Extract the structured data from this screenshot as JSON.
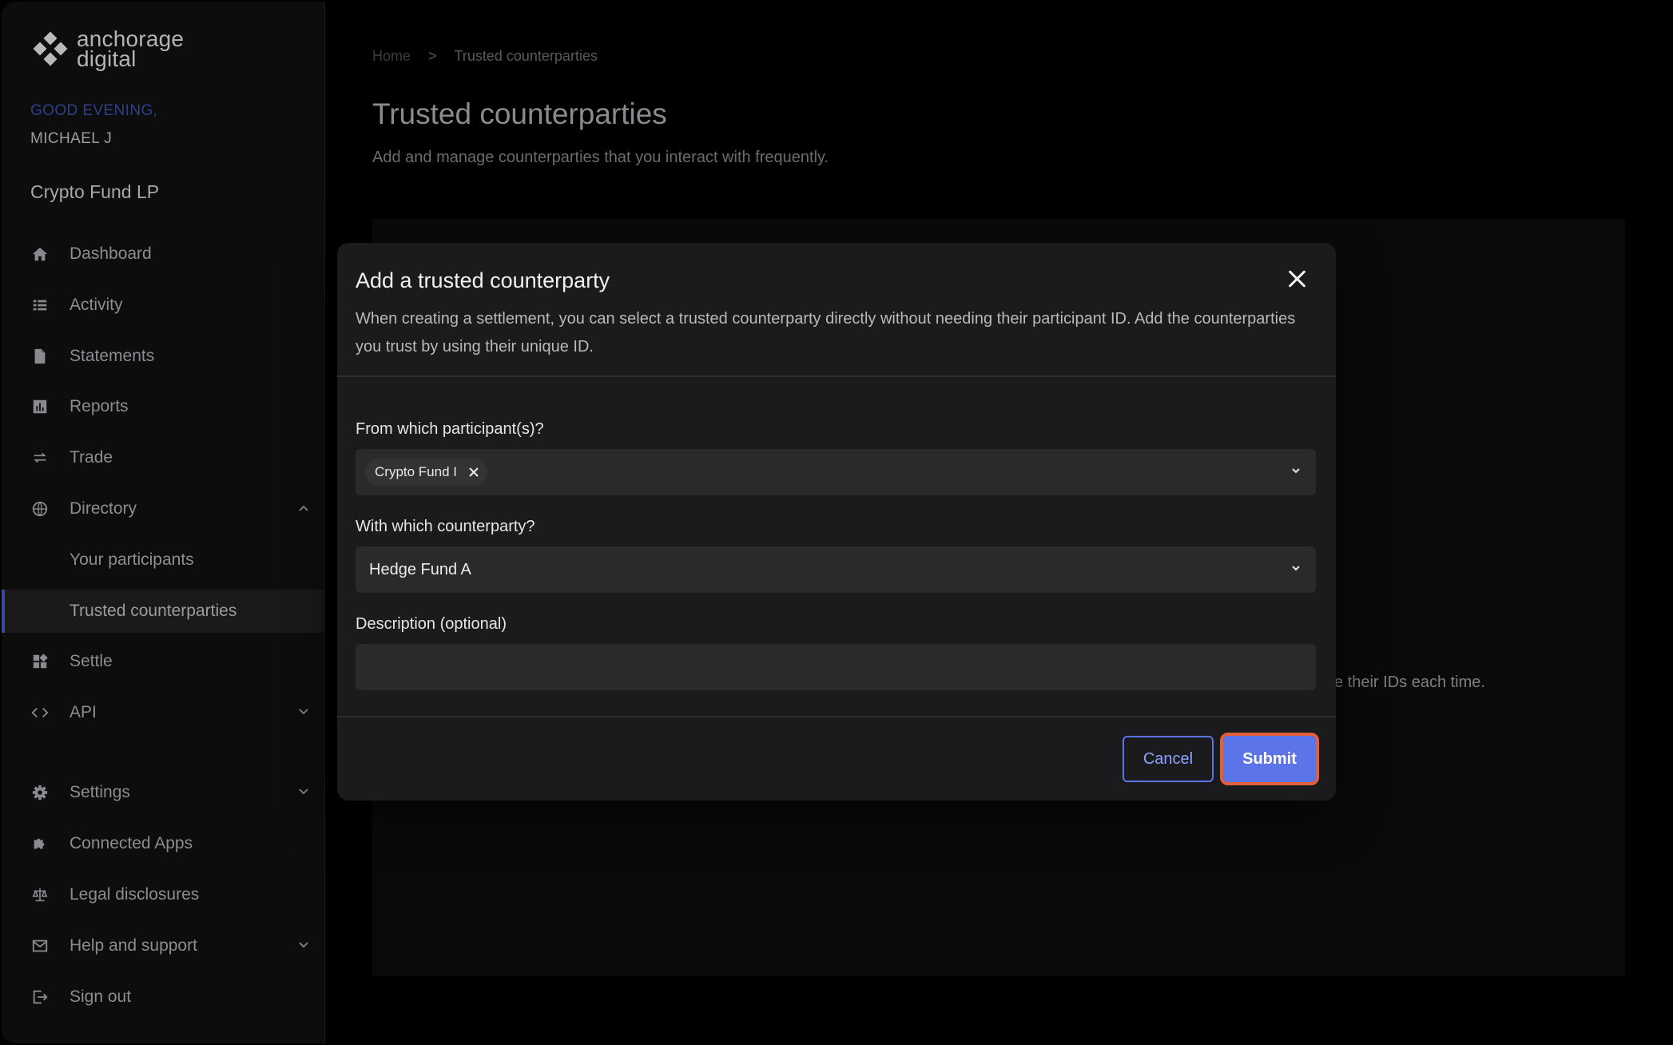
{
  "sidebar": {
    "brand": {
      "line1": "anchorage",
      "line2": "digital"
    },
    "greeting": "GOOD EVENING,",
    "user": "MICHAEL J",
    "org": "Crypto Fund LP",
    "items": [
      {
        "label": "Dashboard",
        "icon": "home-icon"
      },
      {
        "label": "Activity",
        "icon": "list-icon"
      },
      {
        "label": "Statements",
        "icon": "document-icon"
      },
      {
        "label": "Reports",
        "icon": "bar-chart-icon"
      },
      {
        "label": "Trade",
        "icon": "arrows-icon"
      },
      {
        "label": "Directory",
        "icon": "globe-icon",
        "expanded": true
      },
      {
        "label": "Your participants"
      },
      {
        "label": "Trusted counterparties",
        "active": true
      },
      {
        "label": "Settle",
        "icon": "grid-icon"
      },
      {
        "label": "API",
        "icon": "code-icon"
      },
      {
        "label": "Settings",
        "icon": "gear-icon"
      },
      {
        "label": "Connected Apps",
        "icon": "puzzle-icon"
      },
      {
        "label": "Legal disclosures",
        "icon": "scale-icon"
      },
      {
        "label": "Help and support",
        "icon": "mail-icon"
      },
      {
        "label": "Sign out",
        "icon": "sign-out-icon"
      }
    ]
  },
  "main": {
    "breadcrumb": {
      "home": "Home",
      "separator": ">",
      "current": "Trusted counterparties"
    },
    "title": "Trusted counterparties",
    "subtitle": "Add and manage counterparties that you interact with frequently.",
    "panel_text": "e their IDs each time."
  },
  "modal": {
    "title": "Add a trusted counterparty",
    "description": "When creating a settlement, you can select a trusted counterparty directly without needing their participant ID. Add the counterparties you trust by using their unique ID.",
    "participants_label": "From which participant(s)?",
    "participant_chip": "Crypto Fund I",
    "counterparty_label": "With which counterparty?",
    "counterparty_value": "Hedge Fund A",
    "description_label": "Description (optional)",
    "description_value": "",
    "cancel_label": "Cancel",
    "submit_label": "Submit"
  },
  "colors": {
    "accent": "#5b74e8",
    "highlight": "#e2603b",
    "modal_bg": "#1b1b1d"
  }
}
